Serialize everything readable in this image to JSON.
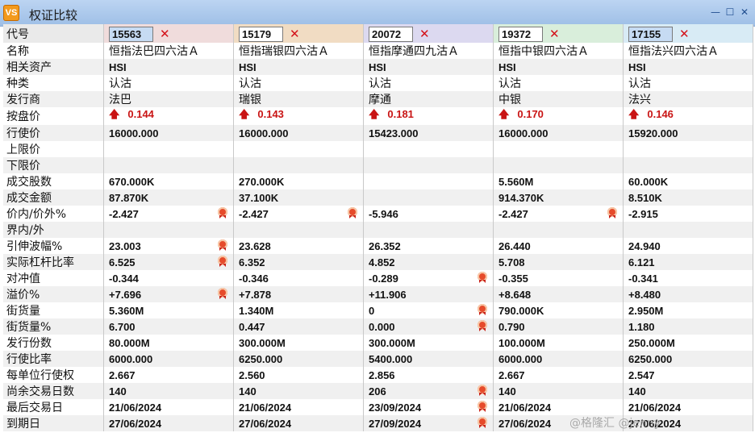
{
  "window": {
    "title": "权证比较",
    "app_icon_text": "VS"
  },
  "codes": [
    {
      "value": "15563",
      "selected": true
    },
    {
      "value": "15179",
      "selected": false
    },
    {
      "value": "20072",
      "selected": false
    },
    {
      "value": "19372",
      "selected": false
    },
    {
      "value": "17155",
      "selected": true
    }
  ],
  "remove_symbol": "✕",
  "price_arrow": "🡅",
  "rows": [
    {
      "label": "代号",
      "type": "head"
    },
    {
      "label": "名称",
      "style": "plain",
      "values": [
        "恒指法巴四六沽Ａ",
        "恒指瑞银四六沽Ａ",
        "恒指摩通四九沽Ａ",
        "恒指中银四六沽Ａ",
        "恒指法兴四六沽Ａ"
      ]
    },
    {
      "label": "相关资产",
      "values": [
        "HSI",
        "HSI",
        "HSI",
        "HSI",
        "HSI"
      ]
    },
    {
      "label": "种类",
      "style": "plain",
      "values": [
        "认沽",
        "认沽",
        "认沽",
        "认沽",
        "认沽"
      ]
    },
    {
      "label": "发行商",
      "style": "plain",
      "values": [
        "法巴",
        "瑞银",
        "摩通",
        "中银",
        "法兴"
      ]
    },
    {
      "label": "按盘价",
      "style": "price",
      "values": [
        "0.144",
        "0.143",
        "0.181",
        "0.170",
        "0.146"
      ]
    },
    {
      "label": "行使价",
      "values": [
        "16000.000",
        "16000.000",
        "15423.000",
        "16000.000",
        "15920.000"
      ]
    },
    {
      "label": "上限价",
      "values": [
        "",
        "",
        "",
        "",
        ""
      ]
    },
    {
      "label": "下限价",
      "values": [
        "",
        "",
        "",
        "",
        ""
      ]
    },
    {
      "label": "成交股数",
      "values": [
        "670.000K",
        "270.000K",
        "",
        "5.560M",
        "60.000K"
      ]
    },
    {
      "label": "成交金额",
      "values": [
        "87.870K",
        "37.100K",
        "",
        "914.370K",
        "8.510K"
      ]
    },
    {
      "label": "价内/价外%",
      "values": [
        "-2.427",
        "-2.427",
        "-5.946",
        "-2.427",
        "-2.915"
      ],
      "badges": [
        0,
        1,
        3
      ]
    },
    {
      "label": "界内/外",
      "values": [
        "",
        "",
        "",
        "",
        ""
      ]
    },
    {
      "label": "引伸波幅%",
      "values": [
        "23.003",
        "23.628",
        "26.352",
        "26.440",
        "24.940"
      ],
      "badges": [
        0
      ]
    },
    {
      "label": "实际杠杆比率",
      "values": [
        "6.525",
        "6.352",
        "4.852",
        "5.708",
        "6.121"
      ],
      "badges": [
        0
      ]
    },
    {
      "label": "对冲值",
      "values": [
        "-0.344",
        "-0.346",
        "-0.289",
        "-0.355",
        "-0.341"
      ],
      "badges": [
        2
      ]
    },
    {
      "label": "溢价%",
      "values": [
        "+7.696",
        "+7.878",
        "+11.906",
        "+8.648",
        "+8.480"
      ],
      "badges": [
        0
      ]
    },
    {
      "label": "街货量",
      "values": [
        "5.360M",
        "1.340M",
        "0",
        "790.000K",
        "2.950M"
      ],
      "badges": [
        2
      ]
    },
    {
      "label": "街货量%",
      "values": [
        "6.700",
        "0.447",
        "0.000",
        "0.790",
        "1.180"
      ],
      "badges": [
        2
      ]
    },
    {
      "label": "发行份数",
      "values": [
        "80.000M",
        "300.000M",
        "300.000M",
        "100.000M",
        "250.000M"
      ]
    },
    {
      "label": "行使比率",
      "values": [
        "6000.000",
        "6250.000",
        "5400.000",
        "6000.000",
        "6250.000"
      ]
    },
    {
      "label": "每单位行使权",
      "values": [
        "2.667",
        "2.560",
        "2.856",
        "2.667",
        "2.547"
      ]
    },
    {
      "label": "尚余交易日数",
      "values": [
        "140",
        "140",
        "206",
        "140",
        "140"
      ],
      "badges": [
        2
      ]
    },
    {
      "label": "最后交易日",
      "values": [
        "21/06/2024",
        "21/06/2024",
        "23/09/2024",
        "21/06/2024",
        "21/06/2024"
      ],
      "badges": [
        2
      ]
    },
    {
      "label": "到期日",
      "values": [
        "27/06/2024",
        "27/06/2024",
        "27/09/2024",
        "27/06/2024",
        "27/06/2024"
      ],
      "badges": [
        2
      ]
    }
  ],
  "watermark": "@格隆汇 @jenny",
  "colors": {
    "header_backgrounds": [
      "#f0dcdc",
      "#f1dcc3",
      "#dcd9f0",
      "#d9eedb",
      "#d8ebf5"
    ],
    "price_up": "#c91414",
    "remove": "#d4131b",
    "badge": "#e64b2b"
  }
}
